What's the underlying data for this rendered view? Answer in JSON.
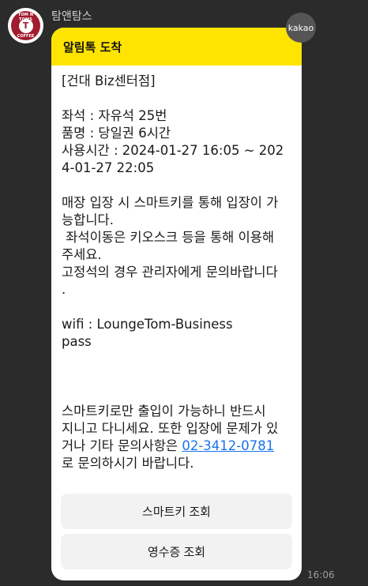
{
  "sender": {
    "name": "탐앤탐스",
    "logo_text_top": "TOM N TOMS",
    "logo_text_bottom": "COFFEE",
    "logo_center": "T"
  },
  "badge": "kakao",
  "header": {
    "title": "알림톡 도착"
  },
  "message": {
    "store": "[건대 Biz센터점]",
    "seat": "좌석 : 자유석 25번",
    "product": "품명 : 당일권 6시간",
    "time_line1": "사용시간 : 2024-01-27 16:05 ~ 202",
    "time_line2": "4-01-27 22:05",
    "notice_line1": "매장 입장 시 스마트키를 통해 입장이 가",
    "notice_line2": "능합니다.",
    "notice_line3": " 좌석이동은 키오스크 등을 통해 이용해",
    "notice_line4": "주세요.",
    "notice_line5": "고정석의 경우 관리자에게 문의바랍니다",
    "notice_line6": ".",
    "wifi": "wifi : LoungeTom-Business",
    "pass": "pass",
    "closing_line1": "스마트키로만 출입이 가능하니 반드시",
    "closing_line2": "지니고 다니세요. 또한 입장에 문제가 있",
    "closing_line3_prefix": "거나 기타 문의사항은 ",
    "phone": "02-3412-0781",
    "closing_line4": "로 문의하시기 바랍니다."
  },
  "buttons": {
    "smartkey": "스마트키 조회",
    "receipt": "영수증 조회"
  },
  "timestamp": "16:06",
  "colors": {
    "header": "#ffe400",
    "link": "#1a73e8",
    "background": "#2b2b2b"
  }
}
